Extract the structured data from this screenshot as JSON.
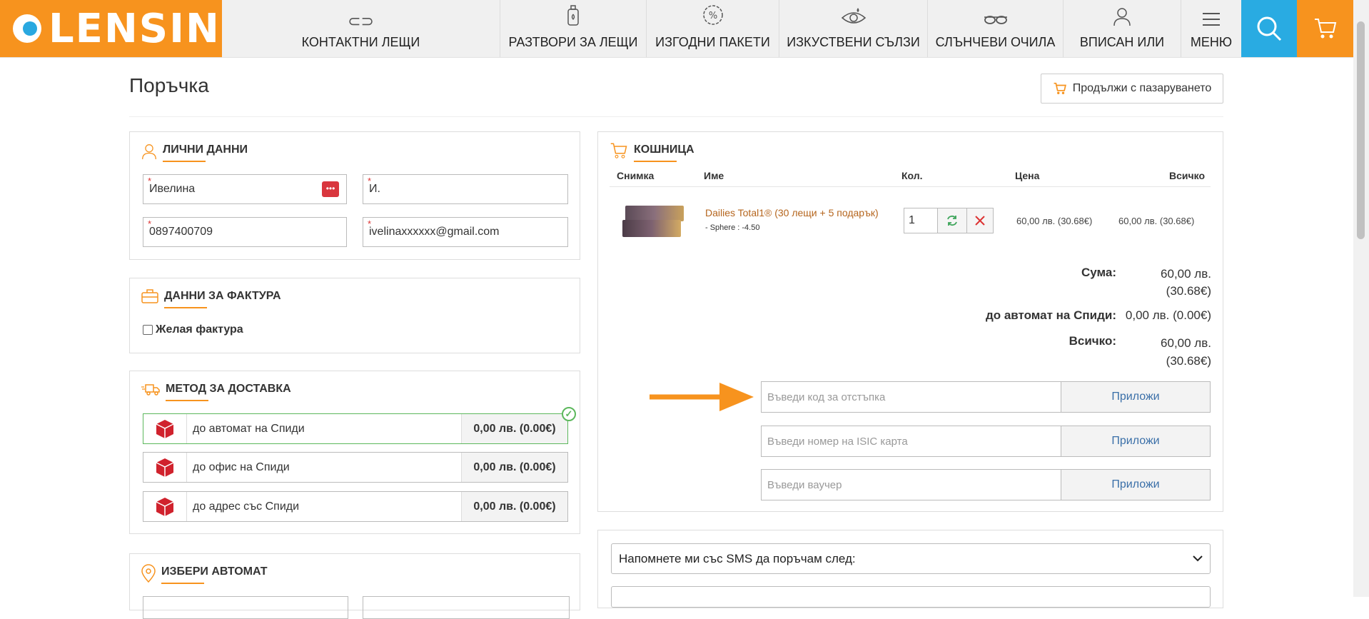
{
  "brand": {
    "name": "LENSIN",
    "accent": "#f7931e",
    "blue": "#29abe2"
  },
  "nav": [
    {
      "label": "КОНТАКТНИ ЛЕЩИ",
      "icon": "lens-icon"
    },
    {
      "label": "РАЗТВОРИ ЗА ЛЕЩИ",
      "icon": "bottle-icon"
    },
    {
      "label": "ИЗГОДНИ ПАКЕТИ",
      "icon": "percent-badge-icon"
    },
    {
      "label": "ИЗКУСТВЕНИ СЪЛЗИ",
      "icon": "eye-drop-icon"
    },
    {
      "label": "СЛЪНЧЕВИ ОЧИЛА",
      "icon": "sunglasses-icon"
    },
    {
      "label": "ВПИСАН ИЛИ",
      "icon": "user-icon"
    },
    {
      "label": "МЕНЮ",
      "icon": "hamburger-icon"
    }
  ],
  "page": {
    "title": "Поръчка",
    "continue_label": "Продължи с пазаруването"
  },
  "personal": {
    "title": "ЛИЧНИ ДАННИ",
    "first_name": "Ивелина",
    "last_name": "И.",
    "phone": "0897400709",
    "email": "ivelinaxxxxxx@gmail.com"
  },
  "invoice": {
    "title": "ДАННИ ЗА ФАКТУРА",
    "checkbox_label": "Желая фактура"
  },
  "delivery": {
    "title": "МЕТОД ЗА ДОСТАВКА",
    "options": [
      {
        "label": "до автомат на Спиди",
        "price": "0,00 лв. (0.00€)",
        "selected": true
      },
      {
        "label": "до офис на Спиди",
        "price": "0,00 лв. (0.00€)",
        "selected": false
      },
      {
        "label": "до адрес със Спиди",
        "price": "0,00 лв. (0.00€)",
        "selected": false
      }
    ]
  },
  "locker": {
    "title": "ИЗБЕРИ АВТОМАТ"
  },
  "cart": {
    "title": "КОШНИЦА",
    "headers": {
      "image": "Снимка",
      "name": "Име",
      "qty": "Кол.",
      "price": "Цена",
      "total": "Всичко"
    },
    "items": [
      {
        "name": "Dailies Total1® (30 лещи + 5 подарък)",
        "option": "- Sphere : -4.50",
        "qty": "1",
        "price": "60,00 лв. (30.68€)",
        "total": "60,00 лв. (30.68€)"
      }
    ],
    "summary": [
      {
        "label": "Сума:",
        "value": "60,00 лв. (30.68€)"
      },
      {
        "label": "до автомат на Спиди:",
        "value": "0,00 лв. (0.00€)"
      },
      {
        "label": "Всичко:",
        "value": "60,00 лв. (30.68€)"
      }
    ],
    "discount_placeholder": "Въведи код за отстъпка",
    "isic_placeholder": "Въведи номер на ISIC карта",
    "voucher_placeholder": "Въведи ваучер",
    "apply_label": "Приложи"
  },
  "sms": {
    "label": "Напомнете ми със SMS да поръчам след:"
  }
}
